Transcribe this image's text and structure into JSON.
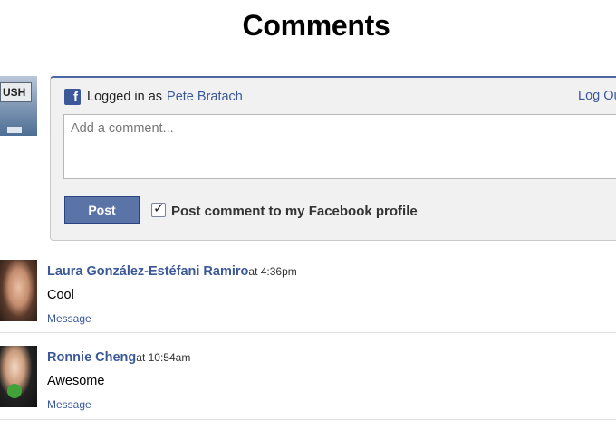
{
  "page": {
    "title": "Comments"
  },
  "composer": {
    "logged_in_prefix": "Logged in as",
    "user_name": "Pete Bratach",
    "logout_label": "Log Out",
    "placeholder": "Add a comment...",
    "post_label": "Post",
    "checkbox_checked": true,
    "checkbox_label": "Post comment to my Facebook profile"
  },
  "comments": [
    {
      "author": "Laura González-Estéfani Ramiro",
      "time": "at 4:36pm",
      "text": "Cool",
      "action": "Message"
    },
    {
      "author": "Ronnie Cheng",
      "time": "at 10:54am",
      "text": "Awesome",
      "action": "Message"
    }
  ],
  "colors": {
    "facebook_blue": "#3b5998",
    "post_button": "#5b74a8"
  }
}
